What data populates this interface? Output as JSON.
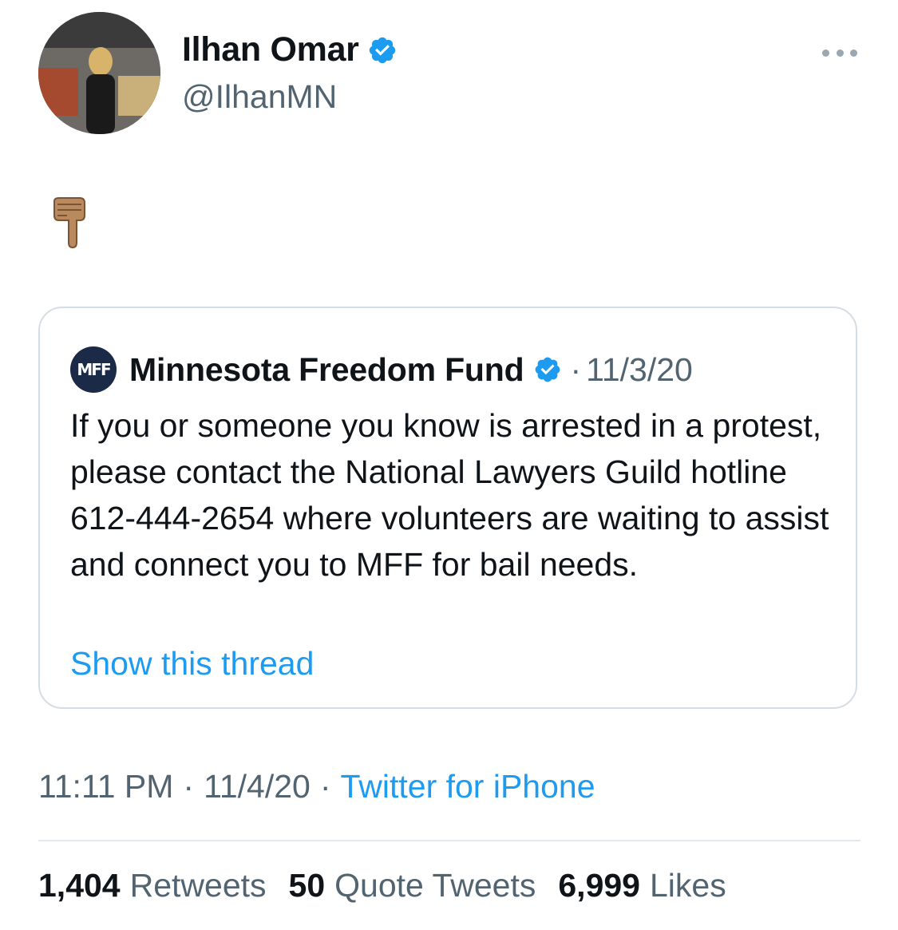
{
  "author": {
    "name": "Ilhan Omar",
    "handle": "@IlhanMN"
  },
  "tweet": {
    "emoji": "pointing-down-hand-medium-skin-tone",
    "timestamp_time": "11:11 PM",
    "timestamp_date": "11/4/20",
    "separator": "·",
    "source": "Twitter for iPhone"
  },
  "quote": {
    "name": "Minnesota Freedom Fund",
    "logo_text": "MFF",
    "separator": "·",
    "date": "11/3/20",
    "body": "If you or someone you know is arrested in a protest, please contact the National Lawyers Guild hotline 612-444-2654 where volunteers are waiting to assist and connect you to MFF for bail needs.",
    "show_thread": "Show this thread"
  },
  "stats": {
    "retweets_count": "1,404",
    "retweets_label": "Retweets",
    "quotes_count": "50",
    "quotes_label": "Quote Tweets",
    "likes_count": "6,999",
    "likes_label": "Likes"
  },
  "colors": {
    "link": "#1d9bf0",
    "secondary_text": "#536471",
    "verified": "#1d9bf0",
    "mff_logo_bg": "#1b2a47"
  }
}
